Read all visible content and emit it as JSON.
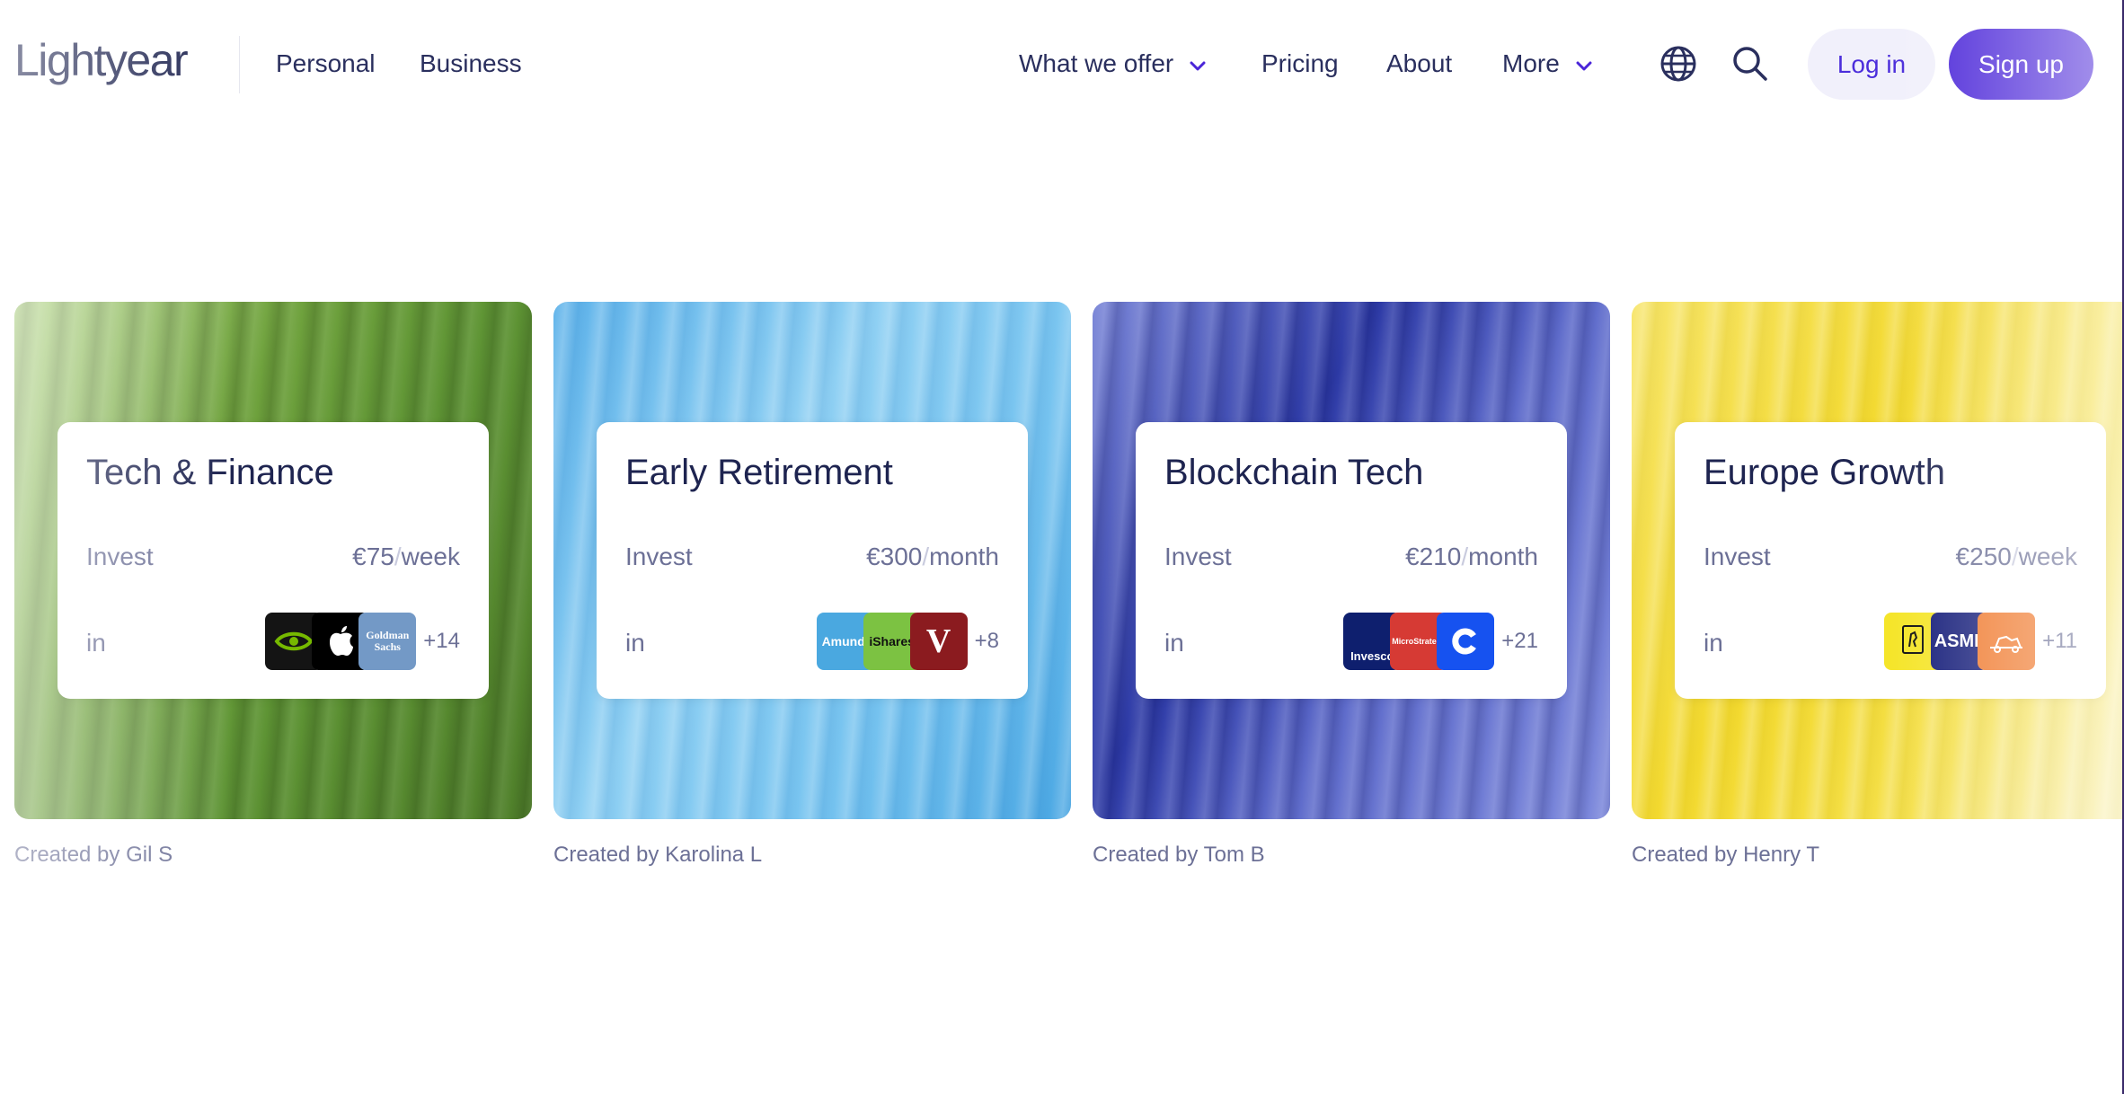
{
  "brand": {
    "name": "Lightyear"
  },
  "nav": {
    "left": [
      {
        "label": "Personal"
      },
      {
        "label": "Business"
      }
    ],
    "right": [
      {
        "label": "What we offer"
      },
      {
        "label": "Pricing"
      },
      {
        "label": "About"
      },
      {
        "label": "More"
      }
    ],
    "login_label": "Log in",
    "signup_label": "Sign up",
    "icons": [
      "globe-icon",
      "search-icon",
      "chevron-down-icon"
    ]
  },
  "colors": {
    "brand": "#4a25d8",
    "text": "#1e2450",
    "muted": "#6c7096",
    "login_bg": "#f1f0fb"
  },
  "cards": [
    {
      "title": "Tech & Finance",
      "invest_label": "Invest",
      "amount": "€75",
      "period": "week",
      "in_label": "in",
      "holdings": [
        "NVIDIA",
        "Apple",
        "Goldman Sachs"
      ],
      "more": "+14",
      "created_prefix": "Created by",
      "creator": "Gil S"
    },
    {
      "title": "Early Retirement",
      "invest_label": "Invest",
      "amount": "€300",
      "period": "month",
      "in_label": "in",
      "holdings": [
        "Amundi",
        "iShares",
        "V"
      ],
      "more": "+8",
      "created_prefix": "Created by",
      "creator": "Karolina L"
    },
    {
      "title": "Blockchain Tech",
      "invest_label": "Invest",
      "amount": "€210",
      "period": "month",
      "in_label": "in",
      "holdings": [
        "Invesco",
        "MicroStrategy",
        "Coinbase"
      ],
      "more": "+21",
      "created_prefix": "Created by",
      "creator": "Tom B"
    },
    {
      "title": "Europe Growth",
      "invest_label": "Invest",
      "amount": "€250",
      "period": "week",
      "in_label": "in",
      "holdings": [
        "Ferrari",
        "ASML",
        "Hermès"
      ],
      "more": "+11",
      "created_prefix": "Created by",
      "creator": "Henry T"
    }
  ]
}
